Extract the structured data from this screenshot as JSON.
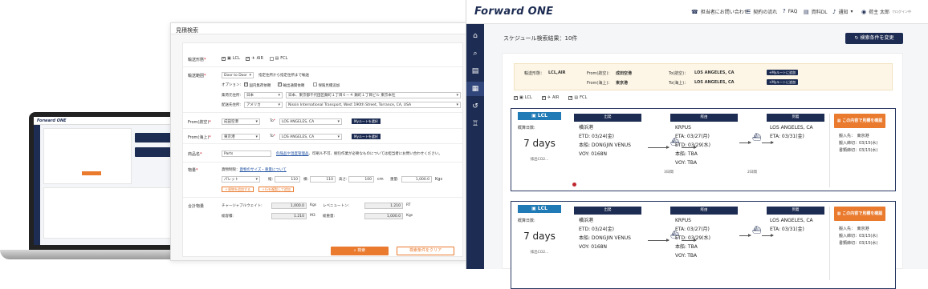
{
  "laptop": {
    "logo": "Forward ONE"
  },
  "search": {
    "title": "見積検索",
    "transport_mode_label": "輸送形態",
    "modes": [
      {
        "label": "LCL",
        "checked": true
      },
      {
        "label": "AIR",
        "checked": true
      },
      {
        "label": "FCL",
        "checked": false
      }
    ],
    "range_label": "輸送範囲",
    "range_value": "Door to Door",
    "range_desc": "指定住所から指定住所まで輸送",
    "options_label": "オプション:",
    "option_domestic": "国内集荷依頼",
    "option_customs": "輸出通関依頼",
    "option_insurance": "保険見積追加",
    "shipper_label": "集荷元住所:",
    "shipper_country": "日本",
    "shipper_address": "日本、東京都千代田区麹町１丁目６－４ 麹町１丁目ビル 東京本社",
    "consignee_label": "配送先住所:",
    "consignee_country": "アメリカ",
    "consignee_address": "Nissin International Transport, West 190th Street, Torrance, CA, USA",
    "from_air_label": "From(航空)",
    "from_air_value": "成田空港",
    "to_label": "To",
    "to_air_value": "LOS ANGELES, CA",
    "my_route_btn": "Myルートを選択",
    "from_sea_label": "From(海上)",
    "from_sea_value": "東京港",
    "to_sea_value": "LOS ANGELES, CA",
    "goods_label": "商品名",
    "goods_value": "Parts",
    "goods_note_link": "危険品や温度管理品",
    "goods_note": "、印刷ル不可、梱包作業が必要なものについては担当者にお問い合わせください。",
    "cargo_label": "物量",
    "cargo_note_prefix": "貨物制限：",
    "cargo_note_link": "貨物のサイズ・重量について",
    "package_type": "パレット",
    "length_label": "縦:",
    "length_value": "110",
    "width_label": "横:",
    "width_value": "110",
    "height_label": "高さ:",
    "height_value": "100",
    "dim_unit": "cm",
    "weight_label": "重量:",
    "weight_value": "1,000.0",
    "weight_unit": "Kgs",
    "add_cargo_btn": "＋貨物を追加する",
    "duplicate_btn": "＋行を複製して追加",
    "total_label": "合計物量",
    "chargeable_label": "チャージャブルウェイト:",
    "chargeable_value": "1,000.0",
    "chargeable_unit": "Kgs",
    "revenue_label": "レベニュートン:",
    "revenue_value": "1.210",
    "revenue_unit": "RT",
    "volume_label": "総容積:",
    "volume_value": "1.210",
    "volume_unit": "M3",
    "gross_label": "総重量:",
    "gross_value": "1,000.0",
    "gross_unit": "Kgs",
    "search_btn": "検索",
    "clear_btn": "検索条件をクリア"
  },
  "app": {
    "logo_main": "Forward",
    "logo_accent": "ONE",
    "nav": [
      {
        "icon": "headset-icon",
        "glyph": "☎",
        "label": "担当者にお問い合わせ"
      },
      {
        "icon": "flow-icon",
        "glyph": "☰",
        "label": "契約の流れ"
      },
      {
        "icon": "faq-icon",
        "glyph": "?",
        "label": "FAQ"
      },
      {
        "icon": "document-icon",
        "glyph": "▤",
        "label": "資料DL"
      },
      {
        "icon": "bell-icon",
        "glyph": "♪",
        "label": "通知"
      },
      {
        "icon": "user-icon",
        "glyph": "◉",
        "label": "荷主 太郎"
      }
    ],
    "user_sub": "でログイン中",
    "results_title": "スケジュール検索結果：10件",
    "change_btn": "検索条件を変更",
    "summary": {
      "mode_label": "輸送形態：",
      "mode_value": "LCL,AIR",
      "from_air_label": "From(航空)：",
      "from_air_value": "成田空港",
      "from_sea_label": "From(海上)：",
      "from_sea_value": "東京港",
      "to_air_label": "To(航空)：",
      "to_air_value": "LOS ANGELES, CA",
      "to_sea_label": "To(海上)：",
      "to_sea_value": "LOS ANGELES, CA",
      "my_route_btn": "+Myルートに追加"
    },
    "filters": [
      "LCL",
      "AIR",
      "FCL"
    ],
    "cards": [
      {
        "mode": "LCL",
        "days_label": "概算日数:",
        "days": "7 days",
        "days_sub": "排出CO2...",
        "dep_head": "出発",
        "dep_lines": [
          "横浜港",
          "ETD: 03/24(金)",
          "本船: DONGJIN VENUS",
          "VOY: 0168N"
        ],
        "via_head": "経由",
        "via_lines": [
          "KRPUS",
          "ETA: 03/27(月)",
          "ETD: 03/29(水)",
          "本船: TBA",
          "VOY: TBA"
        ],
        "arr_head": "到着",
        "arr_lines": [
          "LOS ANGELES, CA",
          "ETA: 03/31(金)"
        ],
        "leg1_days": "3日間",
        "leg2_days": "2日間",
        "cta": "この内容で見積を確認",
        "info": [
          "搬入先：　東京港",
          "搬入締切：03/15(水)",
          "書類締切：03/15(水)"
        ]
      },
      {
        "mode": "LCL",
        "days_label": "概算日数:",
        "days": "7 days",
        "days_sub": "排出CO2...",
        "dep_head": "出発",
        "dep_lines": [
          "横浜港",
          "ETD: 03/24(金)",
          "本船: DONGJIN VENUS",
          "VOY: 0168N"
        ],
        "via_head": "経由",
        "via_lines": [
          "KRPUS",
          "ETA: 03/27(月)",
          "ETD: 03/29(水)",
          "本船: TBA",
          "VOY: TBA"
        ],
        "arr_head": "到着",
        "arr_lines": [
          "LOS ANGELES, CA",
          "ETA: 03/31(金)"
        ],
        "leg1_days": "3日間",
        "leg2_days": "2日間",
        "cta": "この内容で見積を確認",
        "info": [
          "搬入先：　東京港",
          "搬入締切：03/15(水)",
          "書類締切：03/15(水)"
        ]
      }
    ]
  }
}
